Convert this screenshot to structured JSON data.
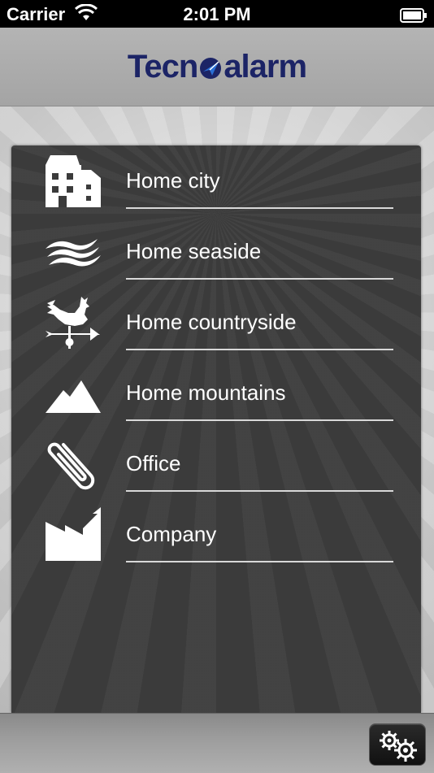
{
  "status_bar": {
    "carrier": "Carrier",
    "time": "2:01 PM"
  },
  "header": {
    "logo_left": "Tecn",
    "logo_right": "alarm"
  },
  "menu": {
    "items": [
      {
        "label": "Home city",
        "icon": "building-icon"
      },
      {
        "label": "Home seaside",
        "icon": "waves-icon"
      },
      {
        "label": "Home countryside",
        "icon": "rooster-weathervane-icon"
      },
      {
        "label": "Home mountains",
        "icon": "mountains-icon"
      },
      {
        "label": "Office",
        "icon": "paperclip-icon"
      },
      {
        "label": "Company",
        "icon": "factory-icon"
      }
    ]
  },
  "footer": {
    "settings_icon": "gears-icon"
  },
  "colors": {
    "logo": "#1c2466",
    "logo_accent": "#2a6fd6",
    "panel": "#3b3b3b"
  }
}
